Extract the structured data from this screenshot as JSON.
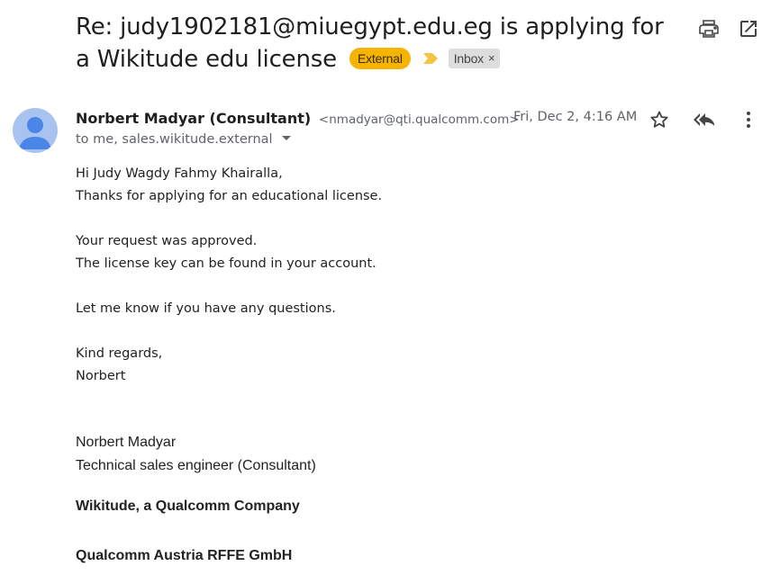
{
  "subject": {
    "text": "Re: judy1902181@miuegypt.edu.eg is applying for a Wikitude edu license",
    "label_external": "External",
    "label_inbox": "Inbox",
    "remove_label_glyph": "×"
  },
  "toolbar": {
    "print_icon": "print-icon",
    "open_new_window_icon": "open-in-new-window-icon"
  },
  "message": {
    "sender_name": "Norbert Madyar (Consultant)",
    "sender_email": "<nmadyar@qti.qualcomm.com>",
    "date": "Fri, Dec 2, 4:16 AM",
    "recipients": "to me, sales.wikitude.external",
    "body_lines": [
      "Hi Judy Wagdy Fahmy Khairalla,",
      "Thanks for applying for an educational license.",
      "",
      "Your request was approved.",
      "The license key can be found in your account.",
      "",
      "Let me know if you have any questions.",
      "",
      "Kind regards,",
      "Norbert"
    ],
    "signature": {
      "name": "Norbert Madyar",
      "title": "Technical sales engineer (Consultant)",
      "company": "Wikitude, a Qualcomm Company",
      "legal_entity": "Qualcomm Austria RFFE GmbH"
    }
  },
  "colors": {
    "external_badge": "#f4b400",
    "important_marker": "#f4c542",
    "avatar_bg": "#a9c3f0",
    "avatar_fg": "#4a86e8"
  }
}
